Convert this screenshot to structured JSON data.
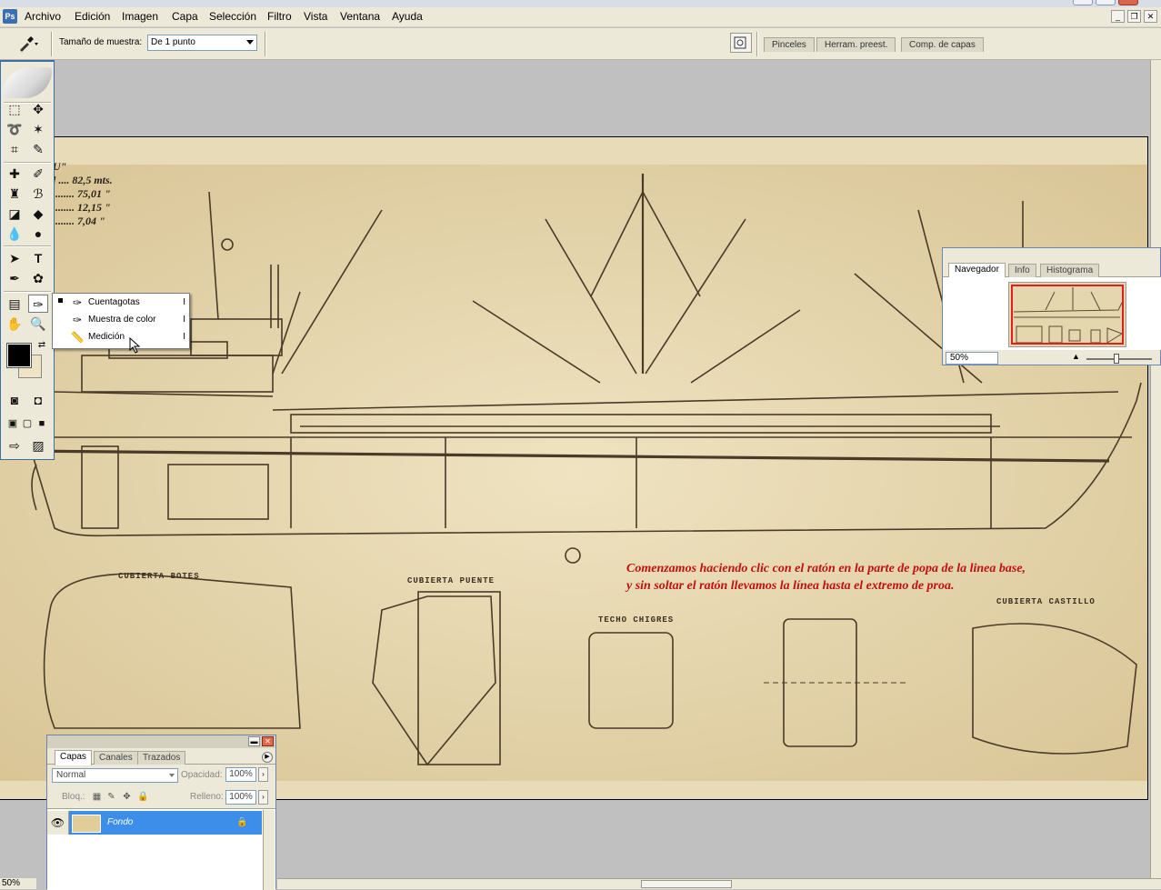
{
  "menubar": {
    "items": [
      "Archivo",
      "Edición",
      "Imagen",
      "Capa",
      "Selección",
      "Filtro",
      "Vista",
      "Ventana",
      "Ayuda"
    ]
  },
  "options": {
    "sample_size_label": "Tamaño de muestra:",
    "sample_size_value": "De 1 punto",
    "palette_tabs": [
      "Pinceles",
      "Herram. preest.",
      "Comp. de capas"
    ]
  },
  "flyout": {
    "items": [
      {
        "label": "Cuentagotas",
        "shortcut": "I",
        "selected": true
      },
      {
        "label": "Muestra de color",
        "shortcut": "I"
      },
      {
        "label": "Medición",
        "shortcut": "I"
      }
    ]
  },
  "navigator": {
    "tabs": [
      "Navegador",
      "Info",
      "Histograma"
    ],
    "zoom": "50%"
  },
  "layers": {
    "tabs": [
      "Capas",
      "Canales",
      "Trazados"
    ],
    "blend_mode": "Normal",
    "opacity_label": "Opacidad:",
    "opacity_value": "100%",
    "lock_label": "Bloq.:",
    "fill_label": "Relleno:",
    "fill_value": "100%",
    "layer_name": "Fondo"
  },
  "document": {
    "zoom": "50%",
    "specs": [
      "U\"",
      "l ....  82,5 mts.",
      "........ 75,01 \"",
      "........ 12,15 \"",
      "........  7,04 \""
    ],
    "deck_labels": [
      "CUBIERTA BOTES",
      "CUBIERTA PUENTE",
      "TECHO CHIGRES",
      "CUBIERTA CASTILLO"
    ],
    "annotation_line1": "Comenzamos haciendo clic con el ratón en la parte de popa de la linea base,",
    "annotation_line2": "y sin soltar el ratón llevamos la línea hasta el extremo de proa."
  },
  "colors": {
    "paper": "#e8dcb8",
    "ink": "#4a3a28",
    "annotation": "#c01010",
    "layer_selected": "#3d8ee8",
    "panel_border": "#6b85b0"
  }
}
